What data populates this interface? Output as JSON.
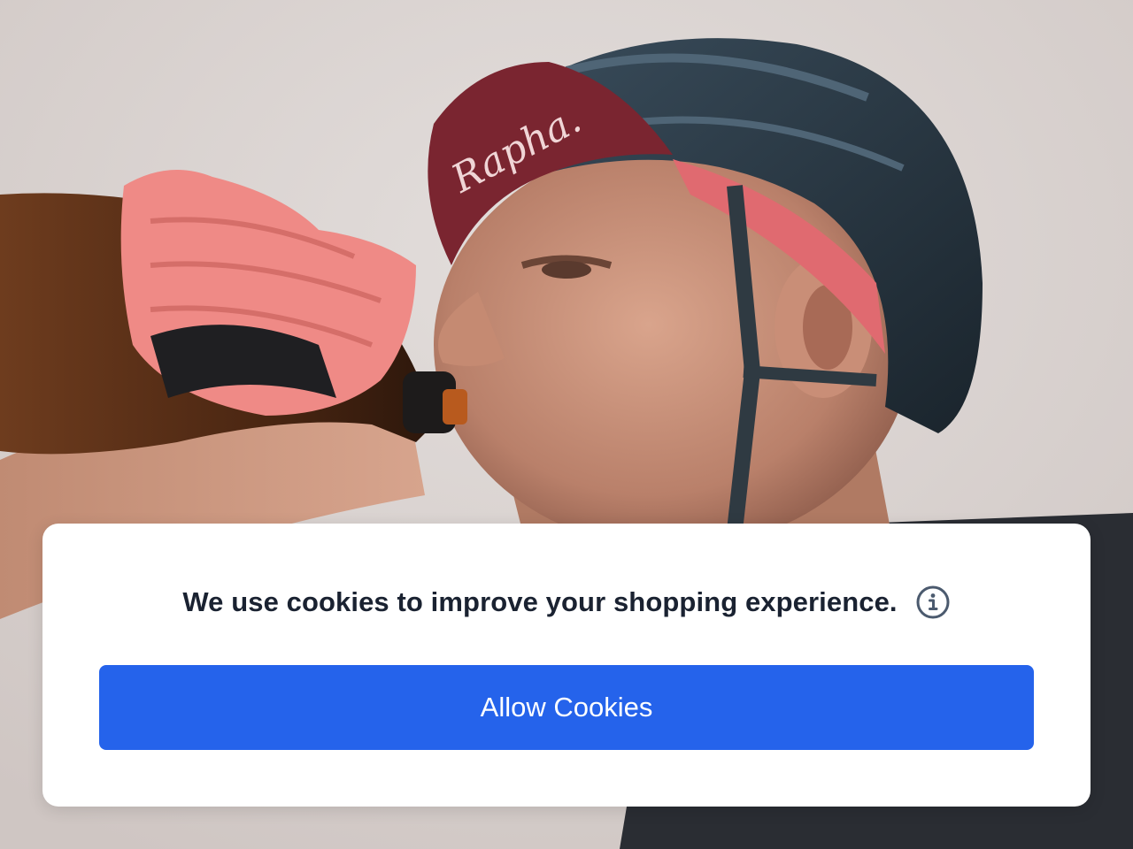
{
  "hero": {
    "cap_logo_text": "Rapha."
  },
  "cookie_banner": {
    "message": "We use cookies to improve your shopping experience.",
    "info_icon": "info-circle-icon",
    "allow_button_label": "Allow Cookies"
  },
  "colors": {
    "button_background": "#2563eb",
    "button_text": "#ffffff",
    "message_text": "#1a2231",
    "info_icon": "#4b5a6e",
    "banner_background": "#ffffff"
  }
}
